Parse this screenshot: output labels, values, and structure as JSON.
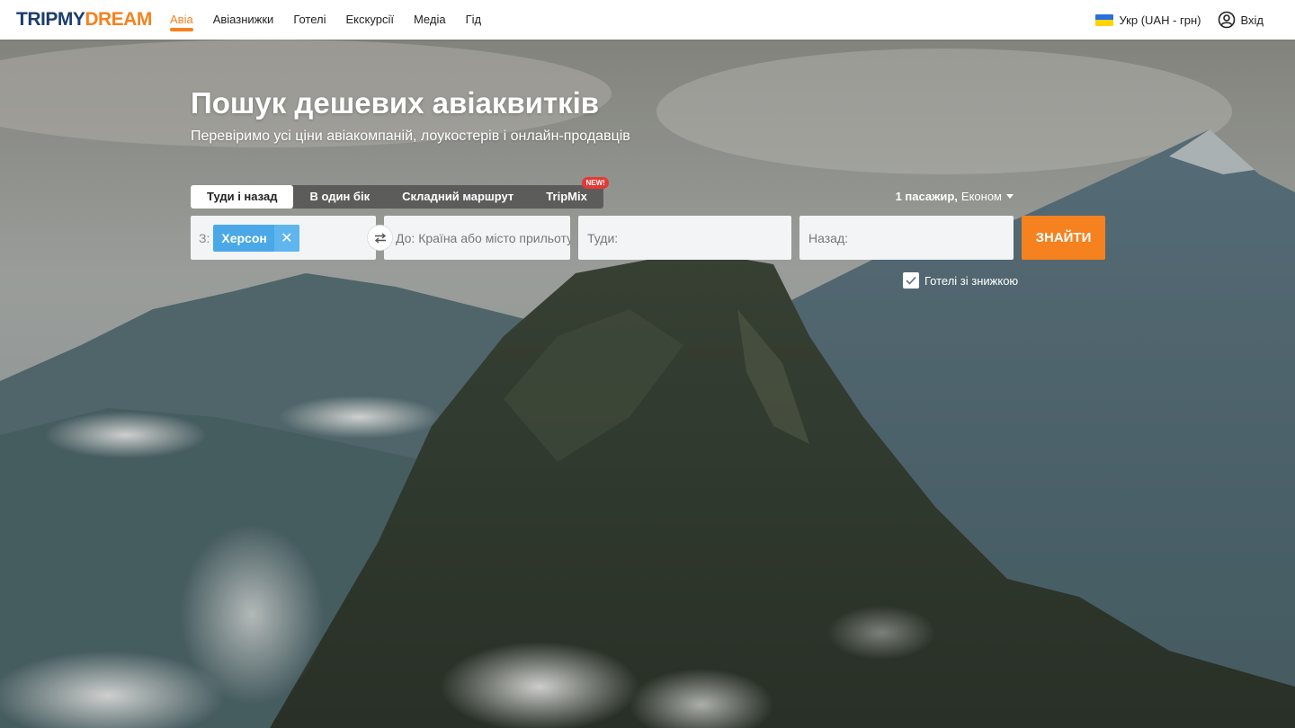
{
  "header": {
    "logo_part1": "TRIPMY",
    "logo_part2": "DREAM",
    "nav": [
      "Авіа",
      "Авіазнижки",
      "Готелі",
      "Екскурсії",
      "Медіа",
      "Гід"
    ],
    "active_nav": "Авіа",
    "language": "Укр (UAH - грн)",
    "login": "Вхід"
  },
  "hero": {
    "title": "Пошук дешевих авіаквитків",
    "subtitle": "Перевіримо усі ціни авіакомпаній, лоукостерів і онлайн-продавців"
  },
  "search": {
    "tabs": [
      "Туди і назад",
      "В один бік",
      "Складний маршрут",
      "TripMix"
    ],
    "active_tab": "Туди і назад",
    "new_badge": "NEW!",
    "passengers_count": "1 пасажир,",
    "cabin_class": "Економ",
    "from_label": "З:",
    "from_value": "Херсон",
    "to_placeholder": "До: Країна або місто прильоту",
    "depart_placeholder": "Туди:",
    "return_placeholder": "Назад:",
    "search_button": "ЗНАЙТИ",
    "hotels_checkbox_label": "Готелі зі знижкою",
    "hotels_checked": true
  },
  "colors": {
    "accent": "#f5821f",
    "logo_blue": "#1c3d6e",
    "chip_blue": "#4aa8e8",
    "badge_red": "#e53935"
  }
}
